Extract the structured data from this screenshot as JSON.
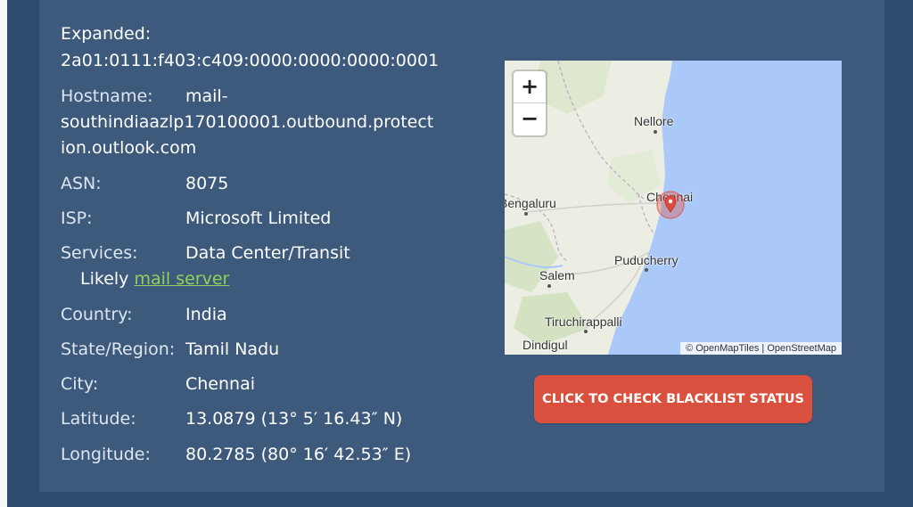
{
  "details": {
    "expanded_label": "Expanded:",
    "expanded_value": "2a01:0111:f403:c409:0000:0000:0000:0001",
    "hostname_label": "Hostname:",
    "hostname_value_line1": "mail-",
    "hostname_value_line2": "southindiaazlp170100001.outbound.protect",
    "hostname_value_line3": "ion.outlook.com",
    "asn_label": "ASN:",
    "asn_value": "8075",
    "isp_label": "ISP:",
    "isp_value": "Microsoft Limited",
    "services_label": "Services:",
    "services_value": "Data Center/Transit",
    "likely_prefix": "Likely",
    "likely_link": "mail server",
    "country_label": "Country:",
    "country_value": "India",
    "state_label": "State/Region:",
    "state_value": "Tamil Nadu",
    "city_label": "City:",
    "city_value": "Chennai",
    "latitude_label": "Latitude:",
    "latitude_value": "13.0879 (13° 5′ 16.43″ N)",
    "longitude_label": "Longitude:",
    "longitude_value": "80.2785 (80° 16′ 42.53″ E)"
  },
  "map": {
    "zoom_in": "+",
    "zoom_out": "−",
    "cities": {
      "nellore": "Nellore",
      "chennai": "Chennai",
      "bengaluru": "Bengaluru",
      "puducherry": "Puducherry",
      "salem": "Salem",
      "tiruchirappalli": "Tiruchirappalli",
      "dindigul": "Dindigul"
    },
    "attribution": "© OpenMapTiles | OpenStreetMap",
    "colors": {
      "sea": "#aac8f8",
      "land": "#eceee3",
      "marker": "#e24a3b"
    }
  },
  "cta": {
    "label": "CLICK TO CHECK BLACKLIST STATUS"
  }
}
